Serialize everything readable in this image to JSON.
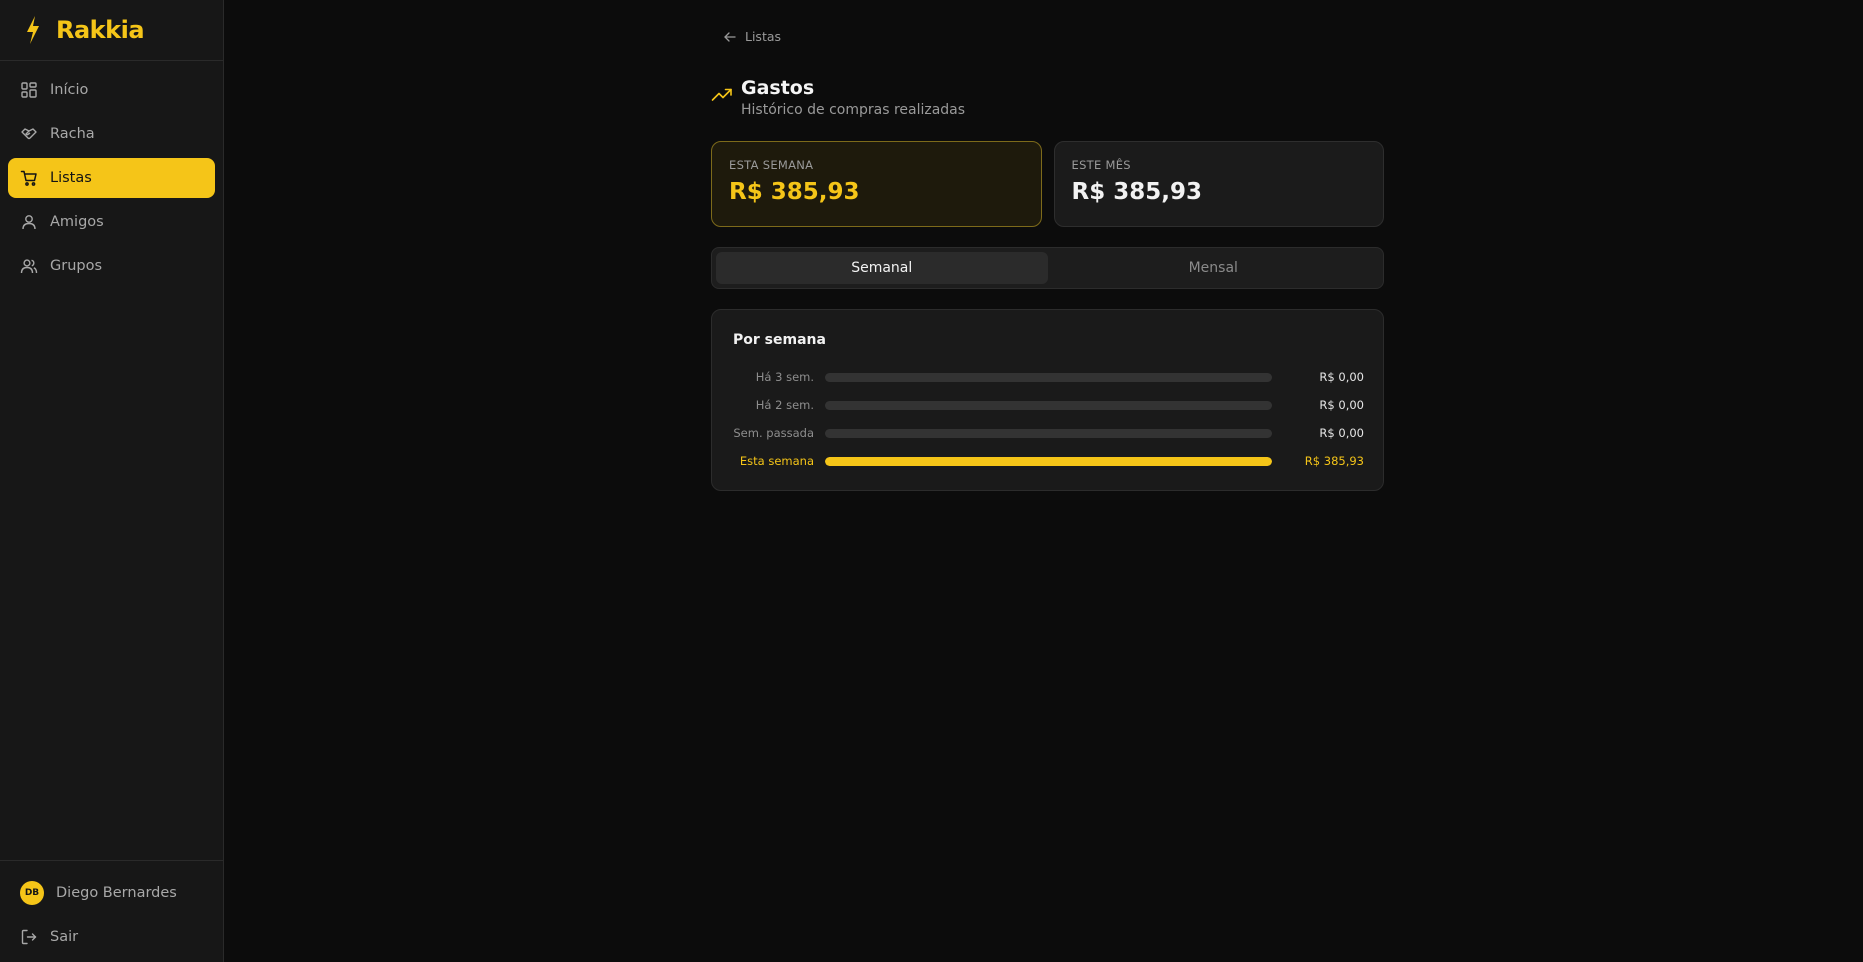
{
  "brand": {
    "name": "Rakkia",
    "accent": "#f5c518"
  },
  "sidebar": {
    "items": [
      {
        "label": "Início",
        "icon": "grid-icon",
        "active": false
      },
      {
        "label": "Racha",
        "icon": "handshake-icon",
        "active": false
      },
      {
        "label": "Listas",
        "icon": "cart-icon",
        "active": true
      },
      {
        "label": "Amigos",
        "icon": "user-icon",
        "active": false
      },
      {
        "label": "Grupos",
        "icon": "users-icon",
        "active": false
      }
    ],
    "user": {
      "initials": "DB",
      "name": "Diego Bernardes"
    },
    "logout_label": "Sair"
  },
  "page": {
    "back_label": "Listas",
    "title": "Gastos",
    "subtitle": "Histórico de compras realizadas"
  },
  "summary": {
    "week": {
      "label": "ESTA SEMANA",
      "value": "R$ 385,93"
    },
    "month": {
      "label": "ESTE MÊS",
      "value": "R$ 385,93"
    }
  },
  "tabs": [
    {
      "label": "Semanal",
      "active": true
    },
    {
      "label": "Mensal",
      "active": false
    }
  ],
  "chart": {
    "title": "Por semana",
    "rows": [
      {
        "label": "Há 3 sem.",
        "value": "R$ 0,00",
        "amount": 0,
        "current": false
      },
      {
        "label": "Há 2 sem.",
        "value": "R$ 0,00",
        "amount": 0,
        "current": false
      },
      {
        "label": "Sem. passada",
        "value": "R$ 0,00",
        "amount": 0,
        "current": false
      },
      {
        "label": "Esta semana",
        "value": "R$ 385,93",
        "amount": 385.93,
        "current": true
      }
    ]
  }
}
